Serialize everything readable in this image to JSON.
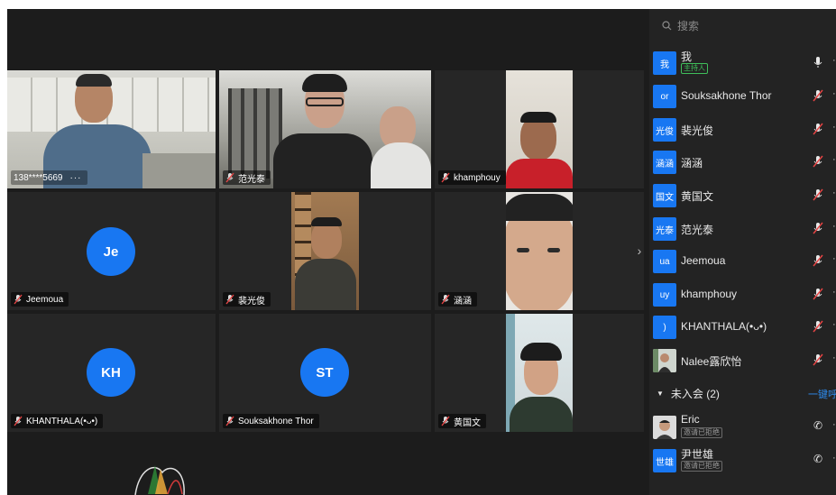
{
  "video_tiles": [
    {
      "name": "138****5669",
      "more": "···",
      "type": "video"
    },
    {
      "name": "范光泰",
      "type": "video"
    },
    {
      "name": "khamphouy",
      "type": "video"
    },
    {
      "name": "Jeemoua",
      "initials": "Je",
      "type": "avatar"
    },
    {
      "name": "裴光俊",
      "type": "video"
    },
    {
      "name": "涵涵",
      "type": "video"
    },
    {
      "name": "KHANTHALA(•ᴗ•)",
      "initials": "KH",
      "type": "avatar"
    },
    {
      "name": "Souksakhone Thor",
      "initials": "ST",
      "type": "avatar"
    },
    {
      "name": "黄国文",
      "type": "video"
    }
  ],
  "next_page_icon": "›",
  "search": {
    "placeholder": "搜索",
    "icon": "search-icon"
  },
  "participants": [
    {
      "avatar": "我",
      "name": "我",
      "badge": "主持人",
      "mic": "on"
    },
    {
      "avatar": "or",
      "name": "Souksakhone Thor",
      "mic": "muted"
    },
    {
      "avatar": "光俊",
      "name": "裴光俊",
      "mic": "muted"
    },
    {
      "avatar": "涵涵",
      "name": "涵涵",
      "mic": "muted"
    },
    {
      "avatar": "国文",
      "name": "黄国文",
      "mic": "muted"
    },
    {
      "avatar": "光泰",
      "name": "范光泰",
      "mic": "muted"
    },
    {
      "avatar": "ua",
      "name": "Jeemoua",
      "mic": "muted"
    },
    {
      "avatar": "uy",
      "name": "khamphouy",
      "mic": "muted"
    },
    {
      "avatar": ")",
      "name": "KHANTHALA(•ᴗ•)",
      "mic": "muted"
    },
    {
      "avatar": "",
      "name": "Nalee露欣怡",
      "mic": "muted"
    }
  ],
  "not_joined": {
    "label": "未入会 (2)",
    "call_all": "一键呼叫"
  },
  "pending": [
    {
      "avatar": "",
      "name": "Eric",
      "status": "邀请已拒绝"
    },
    {
      "avatar": "世雄",
      "name": "尹世雄",
      "status": "邀请已拒绝"
    }
  ],
  "more_label": "···",
  "phone_icon": "✆",
  "colors": {
    "accent": "#1877f2",
    "host_badge": "#3fbf5a",
    "call_link": "#2d8cf0",
    "muted_mic": "#e64545"
  }
}
